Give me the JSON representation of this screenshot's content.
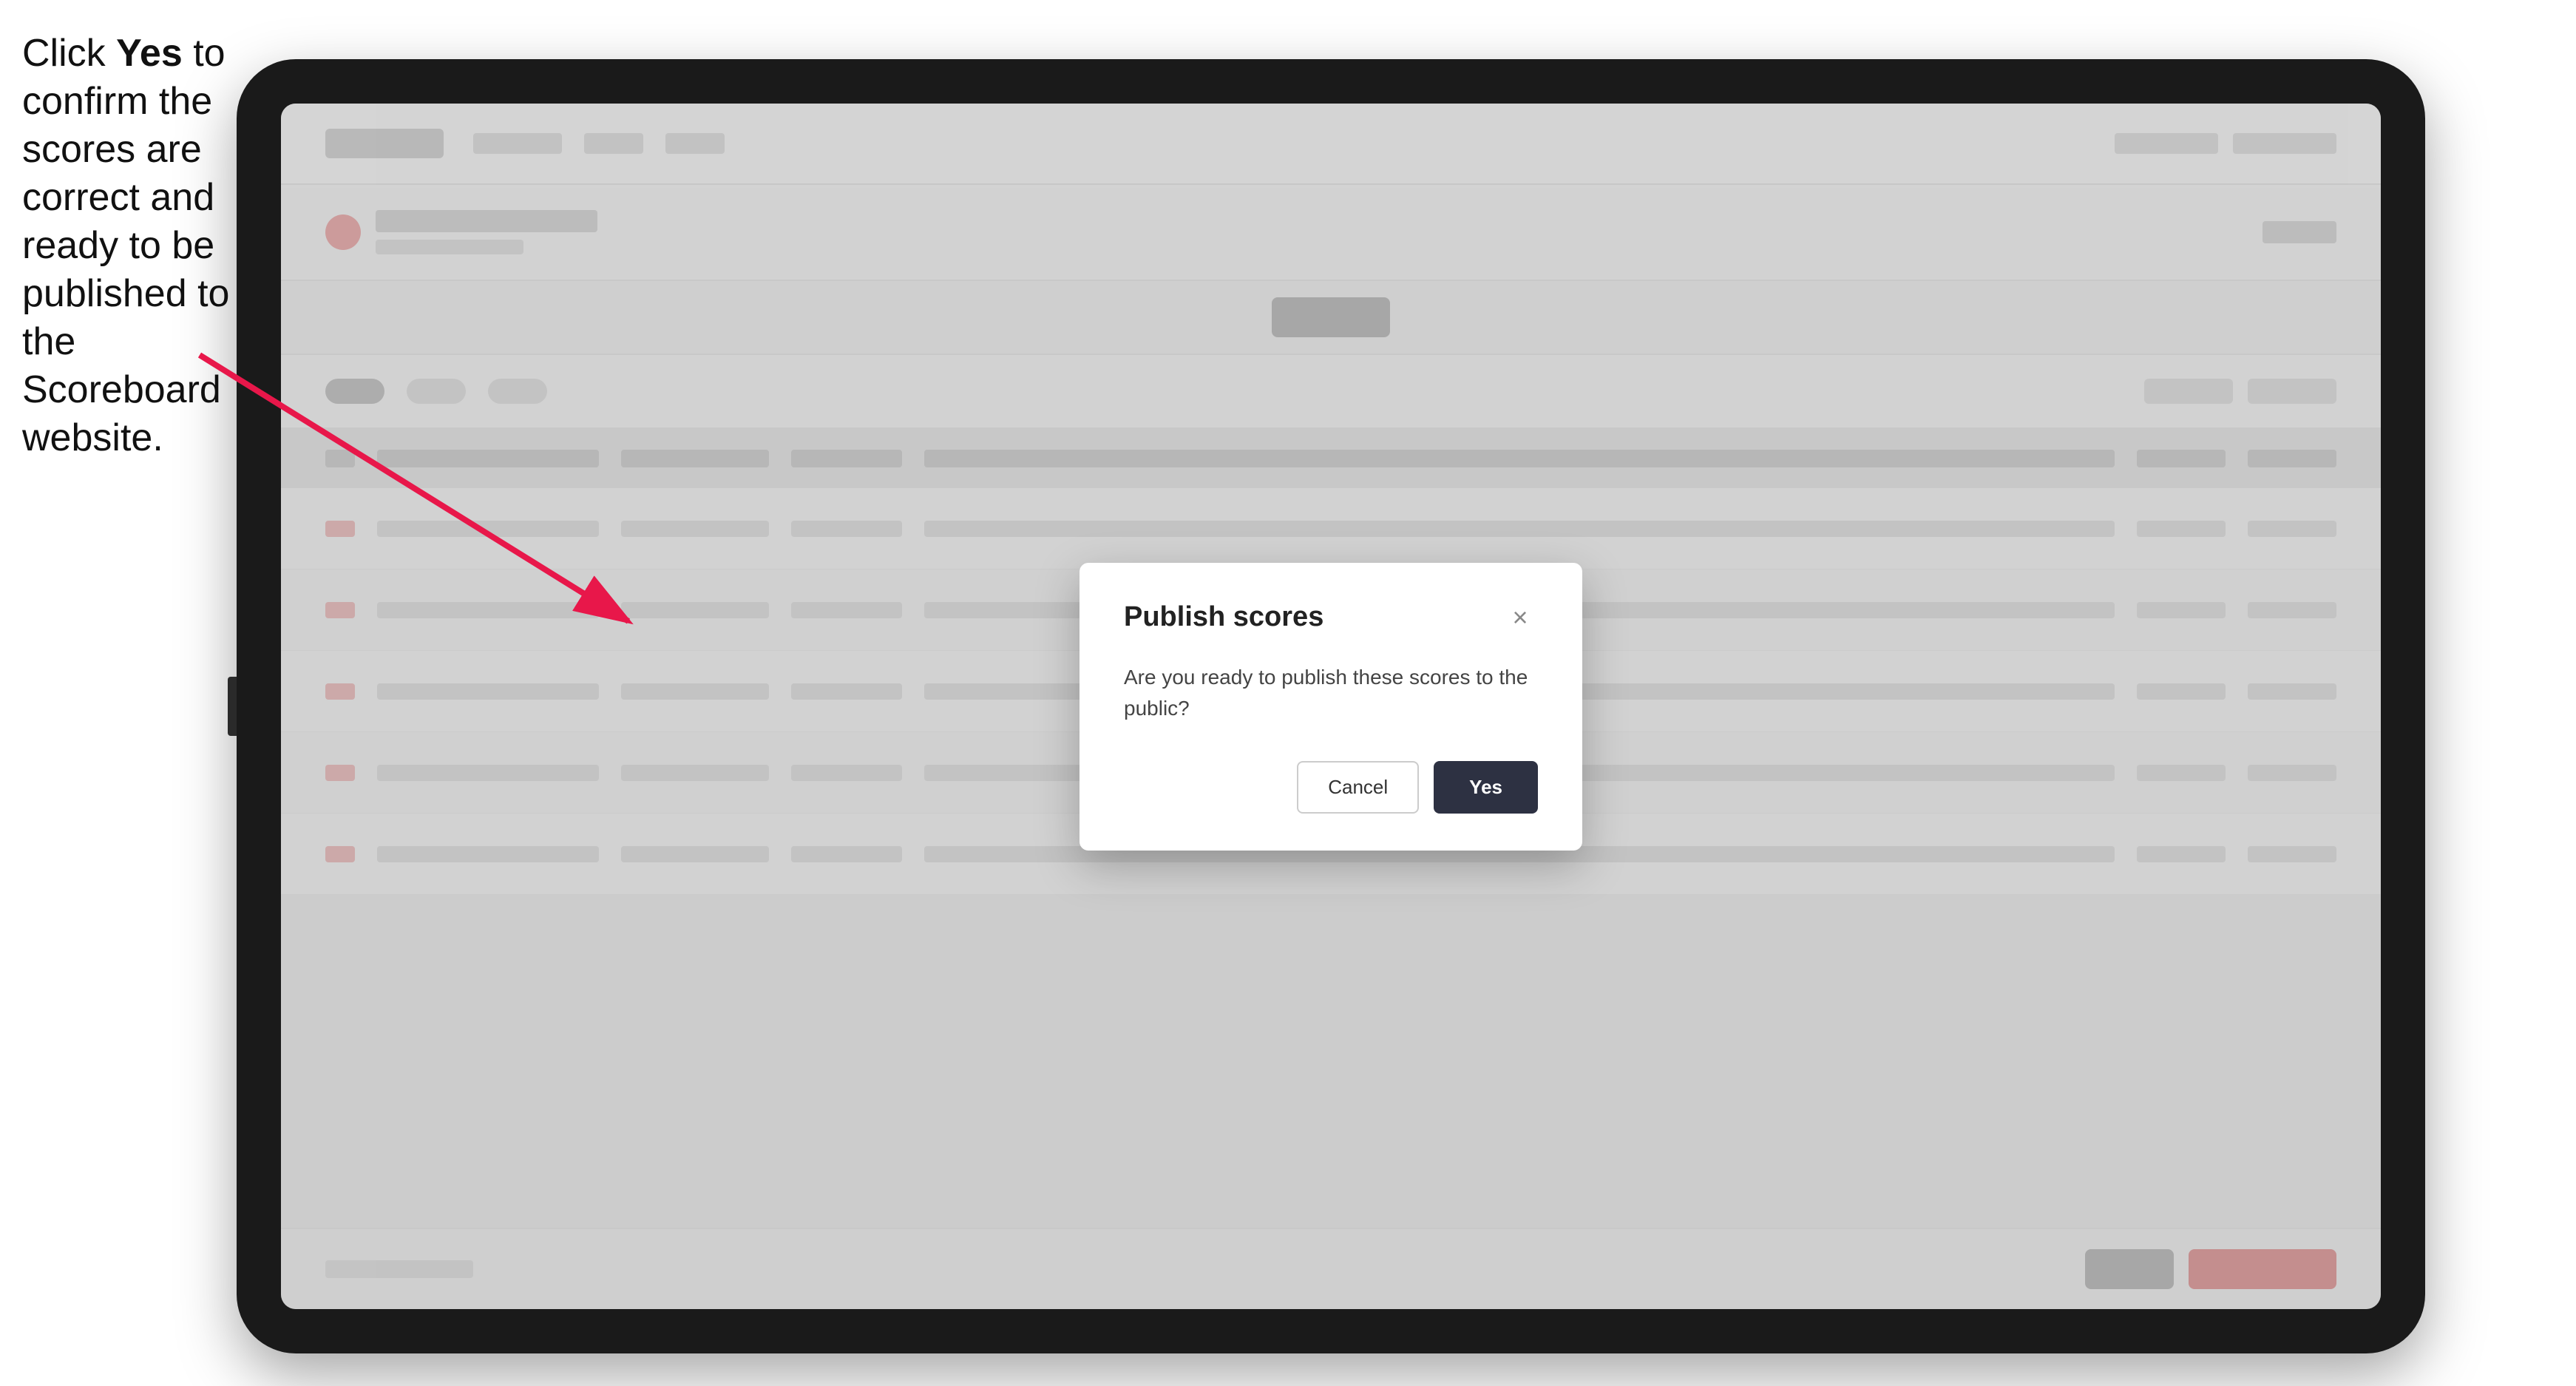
{
  "instruction": {
    "text_part1": "Click ",
    "text_bold": "Yes",
    "text_part2": " to confirm the scores are correct and ready to be published to the Scoreboard website."
  },
  "modal": {
    "title": "Publish scores",
    "body_text": "Are you ready to publish these scores to the public?",
    "close_icon": "×",
    "cancel_label": "Cancel",
    "yes_label": "Yes"
  }
}
